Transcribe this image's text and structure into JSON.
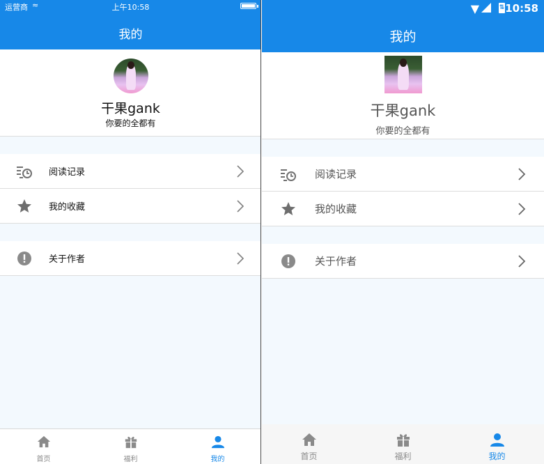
{
  "ios": {
    "status": {
      "carrier": "运营商",
      "time": "上午10:58"
    },
    "title": "我的",
    "profile": {
      "name": "干果gank",
      "signature": "你要的全都有"
    },
    "menu": [
      {
        "icon": "history-icon",
        "label": "阅读记录"
      },
      {
        "icon": "star-icon",
        "label": "我的收藏"
      },
      {
        "icon": "info-icon",
        "label": "关于作者"
      }
    ],
    "tabs": [
      {
        "icon": "home-icon",
        "label": "首页"
      },
      {
        "icon": "gift-icon",
        "label": "福利"
      },
      {
        "icon": "user-icon",
        "label": "我的"
      }
    ]
  },
  "android": {
    "status": {
      "time": "10:58"
    },
    "title": "我的",
    "profile": {
      "name": "干果gank",
      "signature": "你要的全都有"
    },
    "menu": [
      {
        "icon": "history-icon",
        "label": "阅读记录"
      },
      {
        "icon": "star-icon",
        "label": "我的收藏"
      },
      {
        "icon": "info-icon",
        "label": "关于作者"
      }
    ],
    "tabs": [
      {
        "icon": "home-icon",
        "label": "首页"
      },
      {
        "icon": "gift-icon",
        "label": "福利"
      },
      {
        "icon": "user-icon",
        "label": "我的"
      }
    ]
  },
  "active_tab": "我的",
  "colors": {
    "accent": "#1788e8",
    "background": "#f3f9fe",
    "icon": "#707070",
    "inactive": "#8a8a8a"
  }
}
